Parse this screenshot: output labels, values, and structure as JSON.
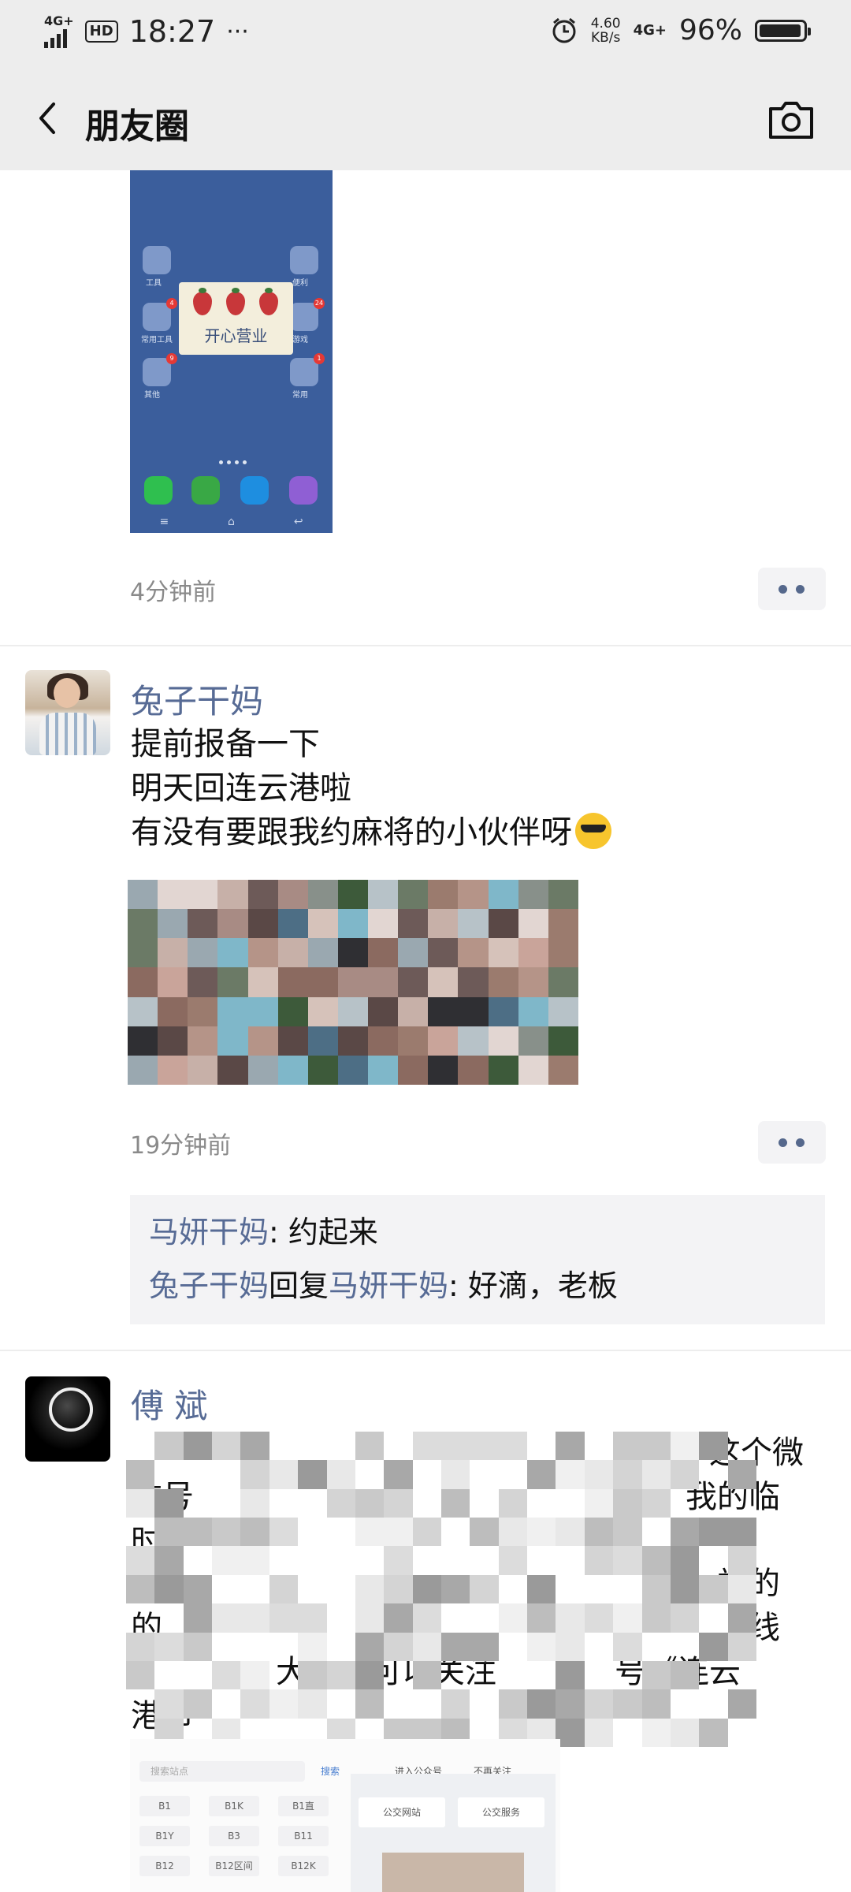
{
  "status_bar": {
    "network": "4G+",
    "hd": "HD",
    "time": "18:27",
    "more": "···",
    "speed_value": "4.60",
    "speed_unit": "KB/s",
    "network2": "4G+",
    "battery": "96%",
    "battery_level": 0.96
  },
  "navbar": {
    "title": "朋友圈"
  },
  "posts": [
    {
      "image": {
        "card_text": "开心营业",
        "icon_labels": [
          "工具",
          "便利",
          "常用工具",
          "游戏",
          "其他",
          "常用"
        ]
      },
      "time": "4分钟前"
    },
    {
      "author": "兔子干妈",
      "lines": [
        "提前报备一下",
        "明天回连云港啦",
        "有没有要跟我约麻将的小伙伴呀"
      ],
      "time": "19分钟前",
      "comments": [
        {
          "name": "马妍干妈",
          "text": ": 约起来"
        },
        {
          "name": "兔子干妈",
          "reply_word": "回复",
          "reply_to": "马妍干妈",
          "text": ": 好滴，老板"
        }
      ]
    },
    {
      "author": "傅  斌",
      "visible_fragments": [
        "务，这个微",
        "信号",
        "我的临",
        "时停",
        "站的",
        "的",
        "线",
        "大",
        "可以关注",
        "号《连云",
        "港市"
      ],
      "shot": {
        "search_placeholder": "搜索站点",
        "search_btn": "搜索",
        "link1": "进入公众号",
        "link2": "不再关注",
        "routes": [
          "B1",
          "B1K",
          "B1直",
          "B1Y",
          "B3",
          "B11",
          "B12",
          "B12区间",
          "B12K"
        ],
        "btn1": "公交网站",
        "btn2": "公交服务"
      }
    }
  ]
}
